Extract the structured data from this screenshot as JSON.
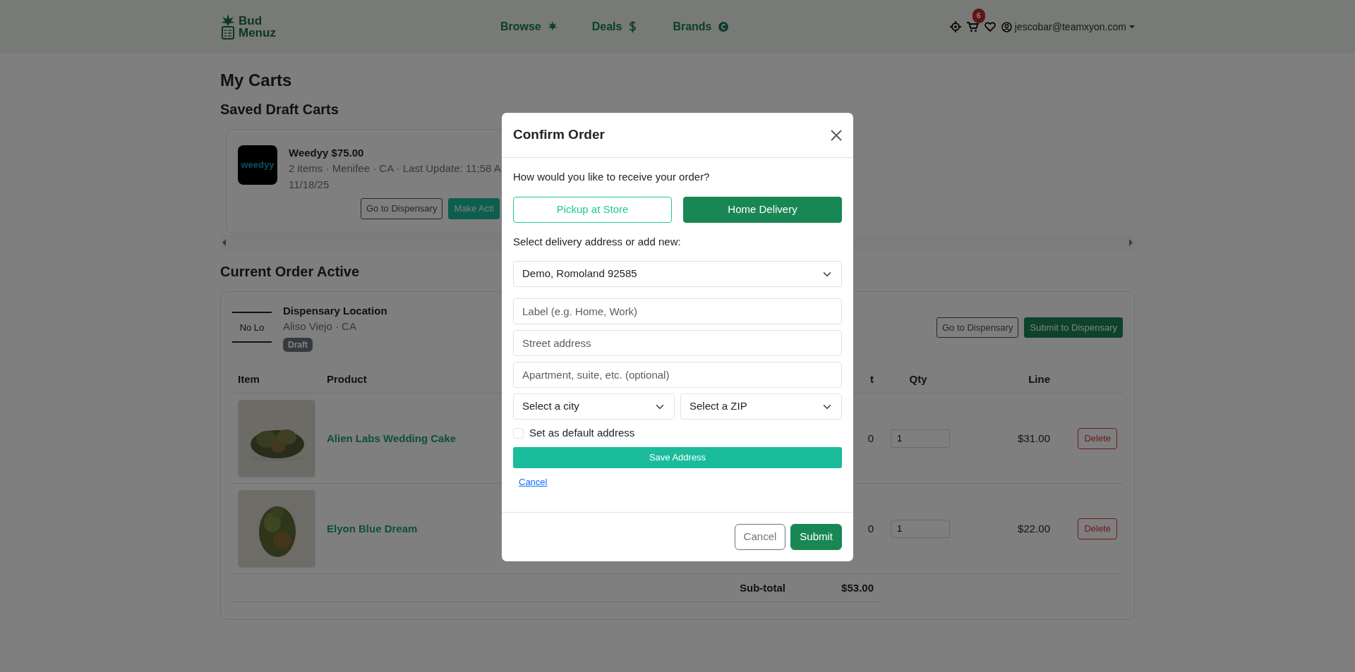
{
  "header": {
    "brand": [
      "Bud",
      "Menuz"
    ],
    "nav": [
      {
        "label": "Browse"
      },
      {
        "label": "Deals"
      },
      {
        "label": "Brands"
      }
    ],
    "cart_badge": "6",
    "user_email": "jescobar@teamxyon.com"
  },
  "page": {
    "title": "My Carts",
    "draft_heading": "Saved Draft Carts",
    "draft_carts": [
      {
        "logo_text": "weedyy",
        "title": "Weedyy $75.00",
        "meta": "2 items · Menifee · CA · Last Update: 11;58 A",
        "date": "11/18/25",
        "buttons": [
          "Go to Dispensary",
          "Make Acti"
        ]
      }
    ],
    "active_heading": "Current Order Active",
    "active_order": {
      "logo_text": "No Lo",
      "name": "Dispensary Location",
      "location": "Aliso Viejo · CA",
      "badge": "Draft",
      "buttons": [
        "Go to Dispensary",
        "Submit to Dispensary"
      ],
      "table": {
        "columns": [
          "Item",
          "Product",
          "t",
          "Qty",
          "Line"
        ],
        "rows": [
          {
            "product": "Alien Labs Wedding Cake",
            "column_3": "0",
            "qty": "1",
            "line": "$31.00",
            "action": "Delete"
          },
          {
            "product": "Elyon Blue Dream",
            "column_3": "0",
            "qty": "1",
            "line": "$22.00",
            "action": "Delete"
          }
        ],
        "subtotal_label": "Sub-total",
        "subtotal": "$53.00"
      }
    }
  },
  "modal": {
    "title": "Confirm Order",
    "question": "How would you like to receive your order?",
    "methods": [
      {
        "label": "Pickup at Store",
        "selected": false
      },
      {
        "label": "Home Delivery",
        "selected": true
      }
    ],
    "address_prompt": "Select delivery address or add new:",
    "address_select": "Demo, Romoland 92585",
    "fields": [
      {
        "placeholder": "Label (e.g. Home, Work)"
      },
      {
        "placeholder": "Street address"
      },
      {
        "placeholder": "Apartment, suite, etc. (optional)"
      }
    ],
    "city_select": "Select a city",
    "zip_select": "Select a ZIP",
    "default_checkbox": {
      "label": "Set as default address",
      "checked": false
    },
    "save_button": "Save Address",
    "cancel_link": "Cancel",
    "footer_buttons": [
      "Cancel",
      "Submit"
    ]
  }
}
